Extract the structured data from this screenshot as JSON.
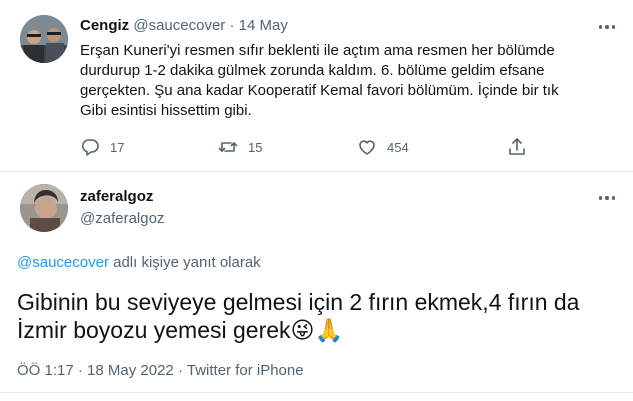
{
  "tweet1": {
    "display_name": "Cengiz",
    "handle": "@saucecover",
    "separator": "·",
    "date": "14 May",
    "text_lines": [
      "Erşan Kuneri'yi resmen sıfır beklenti ile açtım ama resmen her bölümde",
      "durdurup 1-2 dakika gülmek zorunda kaldım. 6. bölüme geldim efsane",
      "gerçekten. Şu ana kadar Kooperatif Kemal favori bölümüm. İçinde bir tık",
      "Gibi esintisi hissettim gibi."
    ],
    "actions": {
      "reply_count": "17",
      "retweet_count": "15",
      "like_count": "454"
    },
    "icons": [
      "more-icon",
      "reply-icon",
      "retweet-icon",
      "like-icon",
      "share-icon"
    ]
  },
  "tweet2": {
    "display_name": "zaferalgoz",
    "handle": "@zaferalgoz",
    "reply_context": {
      "mention": "@saucecover",
      "suffix": " adlı kişiye yanıt olarak"
    },
    "text_lines": [
      "Gibinin bu seviyeye gelmesi için 2 fırın ekmek,4 fırın da",
      "İzmir boyozu yemesi gerek"
    ],
    "emojis": [
      "😜",
      "🙏"
    ],
    "meta": {
      "time": "ÖÖ 1:17",
      "separator": "·",
      "date": "18 May 2022",
      "source": "Twitter for iPhone"
    }
  },
  "colors": {
    "text": "#0f1419",
    "muted": "#536471",
    "link": "#1d9bf0",
    "divider": "#e7ecef"
  }
}
